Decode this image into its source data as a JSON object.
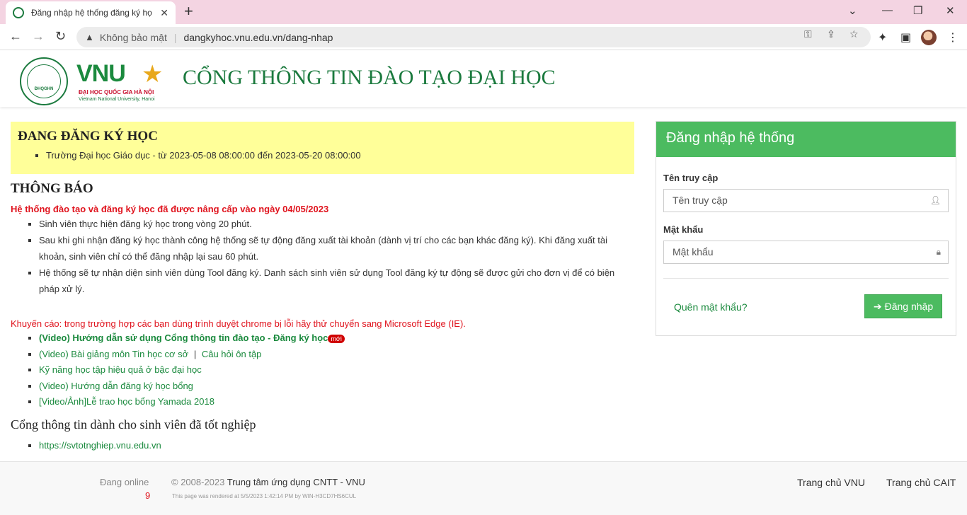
{
  "browser": {
    "tab_title": "Đăng nhập hệ thống đăng ký họ",
    "security_label": "Không bảo mật",
    "url": "dangkyhoc.vnu.edu.vn/dang-nhap"
  },
  "header": {
    "logo_abbr": "ĐHQGHN",
    "logo_text": "VNU",
    "logo_sub1": "ĐẠI HỌC QUỐC GIA HÀ NỘI",
    "logo_sub2": "Vietnam National University, Hanoi",
    "title": "CỔNG THÔNG TIN ĐÀO TẠO ĐẠI HỌC"
  },
  "registration": {
    "heading": "ĐANG ĐĂNG KÝ HỌC",
    "items": [
      "Trường Đại học Giáo dục - từ 2023-05-08 08:00:00 đến 2023-05-20 08:00:00"
    ]
  },
  "notice": {
    "heading": "THÔNG BÁO",
    "upgrade": "Hệ thống đào tạo và đăng ký học đã được nâng cấp vào ngày 04/05/2023",
    "items": [
      "Sinh viên thực hiện đăng ký học trong vòng 20 phút.",
      "Sau khi ghi nhận đăng ký học thành công hệ thống sẽ tự động đăng xuất tài khoản (dành vị trí cho các bạn khác đăng ký). Khi đăng xuất tài khoản, sinh viên chỉ có thể đăng nhập lại sau 60 phút.",
      "Hệ thống sẽ tự nhận diện sinh viên dùng Tool đăng ký. Danh sách sinh viên sử dụng Tool đăng ký tự động sẽ được gửi cho đơn vị để có biện pháp xử lý."
    ],
    "advice": "Khuyến cáo: trong trường hợp các bạn dùng trình duyệt chrome bị lỗi hãy thử chuyển sang Microsoft Edge (IE).",
    "links": {
      "video_guide": "(Video) Hướng dẫn sử dụng Cổng thông tin đào tạo - Đăng ký học",
      "new_badge": "mới",
      "lecture": "(Video) Bài giảng môn Tin học cơ sở",
      "separator": "|",
      "quiz": "Câu hỏi ôn tập",
      "skills": "Kỹ năng học tập hiệu quả ở bậc đại học",
      "scholarship": "(Video) Hướng dẫn đăng ký học bổng",
      "yamada": "[Video/Ảnh]Lễ trao học bổng Yamada 2018"
    },
    "graduate_heading": "Cổng thông tin dành cho sinh viên đã tốt nghiệp",
    "graduate_link": "https://svtotnghiep.vnu.edu.vn"
  },
  "login": {
    "heading": "Đăng nhập hệ thống",
    "username_label": "Tên truy cập",
    "username_placeholder": "Tên truy cập",
    "password_label": "Mật khẩu",
    "password_placeholder": "Mật khẩu",
    "forgot": "Quên mật khẩu?",
    "submit": "Đăng nhập"
  },
  "footer": {
    "online_label": "Đang online",
    "online_count": "9",
    "copyright_prefix": "© 2008-2023",
    "copyright_org": "Trung tâm ứng dụng CNTT - VNU",
    "rendered": "This page was rendered at 5/5/2023 1:42:14 PM by WIN-H3CD7HS6CUL",
    "link_vnu": "Trang chủ VNU",
    "link_cait": "Trang chủ CAIT"
  },
  "colors": {
    "brand_green": "#1b7a3e",
    "login_green": "#4cbb60",
    "alert_red": "#e0141e",
    "highlight_yellow": "#ffff99"
  }
}
